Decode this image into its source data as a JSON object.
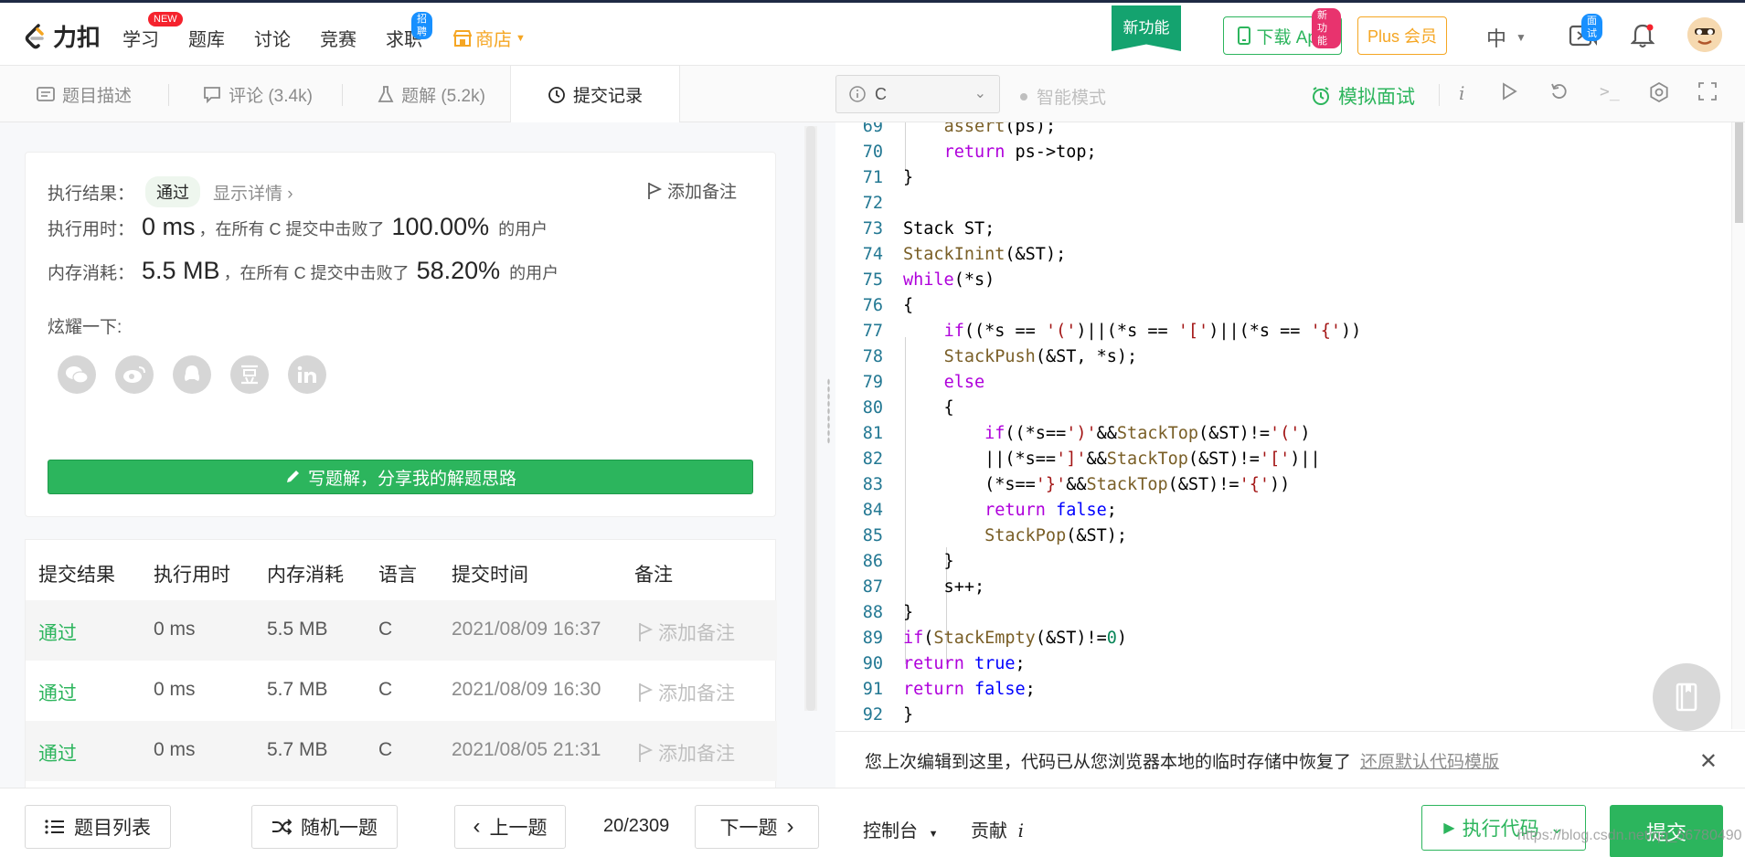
{
  "nav": {
    "brand": "力扣",
    "items": [
      {
        "label": "学习",
        "badge": "NEW"
      },
      {
        "label": "题库"
      },
      {
        "label": "讨论"
      },
      {
        "label": "竞赛"
      },
      {
        "label": "求职",
        "badge": "招聘"
      },
      {
        "label": "商店"
      }
    ],
    "new_feature": "新功能",
    "download": "下载 App",
    "download_badge": "新功能",
    "plus": "Plus 会员",
    "lang": "中",
    "interview_badge": "面试",
    "colors": {
      "green": "#2db55d",
      "orange": "#f5a623",
      "badge_red": "#f5222d"
    }
  },
  "tabs": [
    {
      "label": "题目描述",
      "icon": "document-icon"
    },
    {
      "label": "评论 (3.4k)",
      "icon": "comment-icon"
    },
    {
      "label": "题解 (5.2k)",
      "icon": "flask-icon"
    },
    {
      "label": "提交记录",
      "icon": "clock-icon",
      "active": true
    }
  ],
  "result": {
    "exec_label": "执行结果：",
    "status": "通过",
    "details": "显示详情 ›",
    "add_note": "添加备注",
    "time_label": "执行用时：",
    "time_value": "0 ms",
    "time_mid": "，在所有 C 提交中击败了",
    "time_pct": "100.00%",
    "time_suffix": "的用户",
    "mem_label": "内存消耗：",
    "mem_value": "5.5 MB",
    "mem_mid": "，在所有 C 提交中击败了",
    "mem_pct": "58.20%",
    "mem_suffix": "的用户",
    "share_label": "炫耀一下:",
    "share_icons": [
      "wechat-icon",
      "weibo-icon",
      "qq-icon",
      "douban-icon",
      "linkedin-icon"
    ],
    "write_solution": "写题解，分享我的解题思路"
  },
  "submissions": {
    "headers": [
      "提交结果",
      "执行用时",
      "内存消耗",
      "语言",
      "提交时间",
      "备注"
    ],
    "rows": [
      {
        "status": "通过",
        "time": "0 ms",
        "mem": "5.5 MB",
        "lang": "C",
        "date": "2021/08/09 16:37",
        "note": "添加备注"
      },
      {
        "status": "通过",
        "time": "0 ms",
        "mem": "5.7 MB",
        "lang": "C",
        "date": "2021/08/09 16:30",
        "note": "添加备注"
      },
      {
        "status": "通过",
        "time": "0 ms",
        "mem": "5.7 MB",
        "lang": "C",
        "date": "2021/08/05 21:31",
        "note": "添加备注"
      }
    ]
  },
  "editor": {
    "language": "C",
    "smart_mode": "智能模式",
    "mock_interview": "模拟面试",
    "lines": [
      {
        "n": "69",
        "code": "    assert(ps);"
      },
      {
        "n": "70",
        "code": "    return ps->top;"
      },
      {
        "n": "71",
        "code": "}"
      },
      {
        "n": "72",
        "code": ""
      },
      {
        "n": "73",
        "code": "Stack ST;"
      },
      {
        "n": "74",
        "code": "StackInint(&ST);"
      },
      {
        "n": "75",
        "code": "while(*s)"
      },
      {
        "n": "76",
        "code": "{"
      },
      {
        "n": "77",
        "code": "    if((*s == '(')||(*s == '[')||(*s == '{'))"
      },
      {
        "n": "78",
        "code": "    StackPush(&ST, *s);"
      },
      {
        "n": "79",
        "code": "    else"
      },
      {
        "n": "80",
        "code": "    {"
      },
      {
        "n": "81",
        "code": "        if((*s==')'&&StackTop(&ST)!='(')"
      },
      {
        "n": "82",
        "code": "        ||(*s==']'&&StackTop(&ST)!='[')||"
      },
      {
        "n": "83",
        "code": "        (*s=='}'&&StackTop(&ST)!='{'))"
      },
      {
        "n": "84",
        "code": "        return false;"
      },
      {
        "n": "85",
        "code": "        StackPop(&ST);"
      },
      {
        "n": "86",
        "code": "    }"
      },
      {
        "n": "87",
        "code": "    s++;"
      },
      {
        "n": "88",
        "code": "}"
      },
      {
        "n": "89",
        "code": "if(StackEmpty(&ST)!=0)"
      },
      {
        "n": "90",
        "code": "return true;"
      },
      {
        "n": "91",
        "code": "return false;"
      },
      {
        "n": "92",
        "code": "}"
      }
    ],
    "restore_msg": "您上次编辑到这里，代码已从您浏览器本地的临时存储中恢复了",
    "restore_link": "还原默认代码模版"
  },
  "bottom": {
    "problem_list": "题目列表",
    "random": "随机一题",
    "prev": "上一题",
    "page": "20/2309",
    "next": "下一题",
    "console": "控制台",
    "contribute": "贡献",
    "run": "执行代码",
    "submit": "提交",
    "watermark": "https://blog.csdn.net/qq_56780490"
  }
}
